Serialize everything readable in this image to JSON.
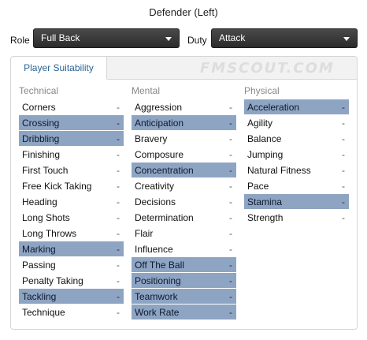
{
  "title": "Defender (Left)",
  "role": {
    "label": "Role",
    "value": "Full Back"
  },
  "duty": {
    "label": "Duty",
    "value": "Attack"
  },
  "tab": {
    "label": "Player Suitability"
  },
  "watermark": "FMSCOUT.COM",
  "colors": {
    "highlight": "#8ea4c3",
    "tab_text": "#2a6496",
    "select_bg": "#333333"
  },
  "columns": [
    {
      "heading": "Technical",
      "items": [
        {
          "label": "Corners",
          "value": "-",
          "key": false
        },
        {
          "label": "Crossing",
          "value": "-",
          "key": true
        },
        {
          "label": "Dribbling",
          "value": "-",
          "key": true
        },
        {
          "label": "Finishing",
          "value": "-",
          "key": false
        },
        {
          "label": "First Touch",
          "value": "-",
          "key": false
        },
        {
          "label": "Free Kick Taking",
          "value": "-",
          "key": false
        },
        {
          "label": "Heading",
          "value": "-",
          "key": false
        },
        {
          "label": "Long Shots",
          "value": "-",
          "key": false
        },
        {
          "label": "Long Throws",
          "value": "-",
          "key": false
        },
        {
          "label": "Marking",
          "value": "-",
          "key": true
        },
        {
          "label": "Passing",
          "value": "-",
          "key": false
        },
        {
          "label": "Penalty Taking",
          "value": "-",
          "key": false
        },
        {
          "label": "Tackling",
          "value": "-",
          "key": true
        },
        {
          "label": "Technique",
          "value": "-",
          "key": false
        }
      ]
    },
    {
      "heading": "Mental",
      "items": [
        {
          "label": "Aggression",
          "value": "-",
          "key": false
        },
        {
          "label": "Anticipation",
          "value": "-",
          "key": true
        },
        {
          "label": "Bravery",
          "value": "-",
          "key": false
        },
        {
          "label": "Composure",
          "value": "-",
          "key": false
        },
        {
          "label": "Concentration",
          "value": "-",
          "key": true
        },
        {
          "label": "Creativity",
          "value": "-",
          "key": false
        },
        {
          "label": "Decisions",
          "value": "-",
          "key": false
        },
        {
          "label": "Determination",
          "value": "-",
          "key": false
        },
        {
          "label": "Flair",
          "value": "-",
          "key": false
        },
        {
          "label": "Influence",
          "value": "-",
          "key": false
        },
        {
          "label": "Off The Ball",
          "value": "-",
          "key": true
        },
        {
          "label": "Positioning",
          "value": "-",
          "key": true
        },
        {
          "label": "Teamwork",
          "value": "-",
          "key": true
        },
        {
          "label": "Work Rate",
          "value": "-",
          "key": true
        }
      ]
    },
    {
      "heading": "Physical",
      "items": [
        {
          "label": "Acceleration",
          "value": "-",
          "key": true
        },
        {
          "label": "Agility",
          "value": "-",
          "key": false
        },
        {
          "label": "Balance",
          "value": "-",
          "key": false
        },
        {
          "label": "Jumping",
          "value": "-",
          "key": false
        },
        {
          "label": "Natural Fitness",
          "value": "-",
          "key": false
        },
        {
          "label": "Pace",
          "value": "-",
          "key": false
        },
        {
          "label": "Stamina",
          "value": "-",
          "key": true
        },
        {
          "label": "Strength",
          "value": "-",
          "key": false
        }
      ]
    }
  ]
}
